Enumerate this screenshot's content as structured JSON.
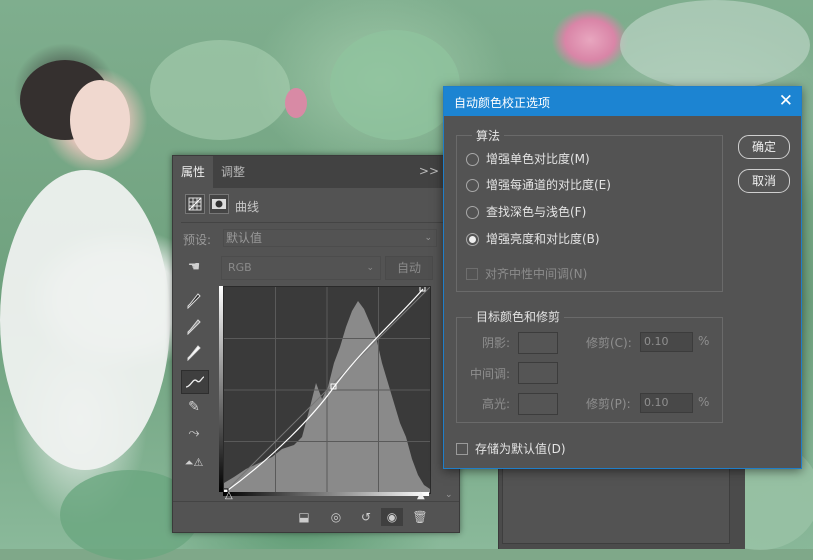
{
  "properties_panel": {
    "tabs": [
      "属性",
      "调整"
    ],
    "menu_glyph": ">>",
    "adjustment_name": "曲线",
    "preset_label": "预设:",
    "preset_value": "默认值",
    "channel": "RGB",
    "auto_label": "自动"
  },
  "dialog": {
    "title": "自动颜色校正选项",
    "close_glyph": "✕",
    "algorithms": {
      "legend": "算法",
      "options": [
        {
          "label": "增强单色对比度(M)",
          "selected": false
        },
        {
          "label": "增强每通道的对比度(E)",
          "selected": false
        },
        {
          "label": "查找深色与浅色(F)",
          "selected": false
        },
        {
          "label": "增强亮度和对比度(B)",
          "selected": true
        }
      ],
      "snap_neutral": "对齐中性中间调(N)"
    },
    "target": {
      "legend": "目标颜色和修剪",
      "shadows_label": "阴影:",
      "midtones_label": "中间调:",
      "highlights_label": "高光:",
      "clip_shadows_label": "修剪(C):",
      "clip_shadows_value": "0.10",
      "clip_highlights_label": "修剪(P):",
      "clip_highlights_value": "0.10",
      "percent": "%"
    },
    "save_default": "存储为默认值(D)",
    "ok_label": "确定",
    "cancel_label": "取消"
  },
  "colors": {
    "panel_bg": "#535353",
    "title_bar": "#1c84d2",
    "histogram": "#8a8a8a"
  }
}
